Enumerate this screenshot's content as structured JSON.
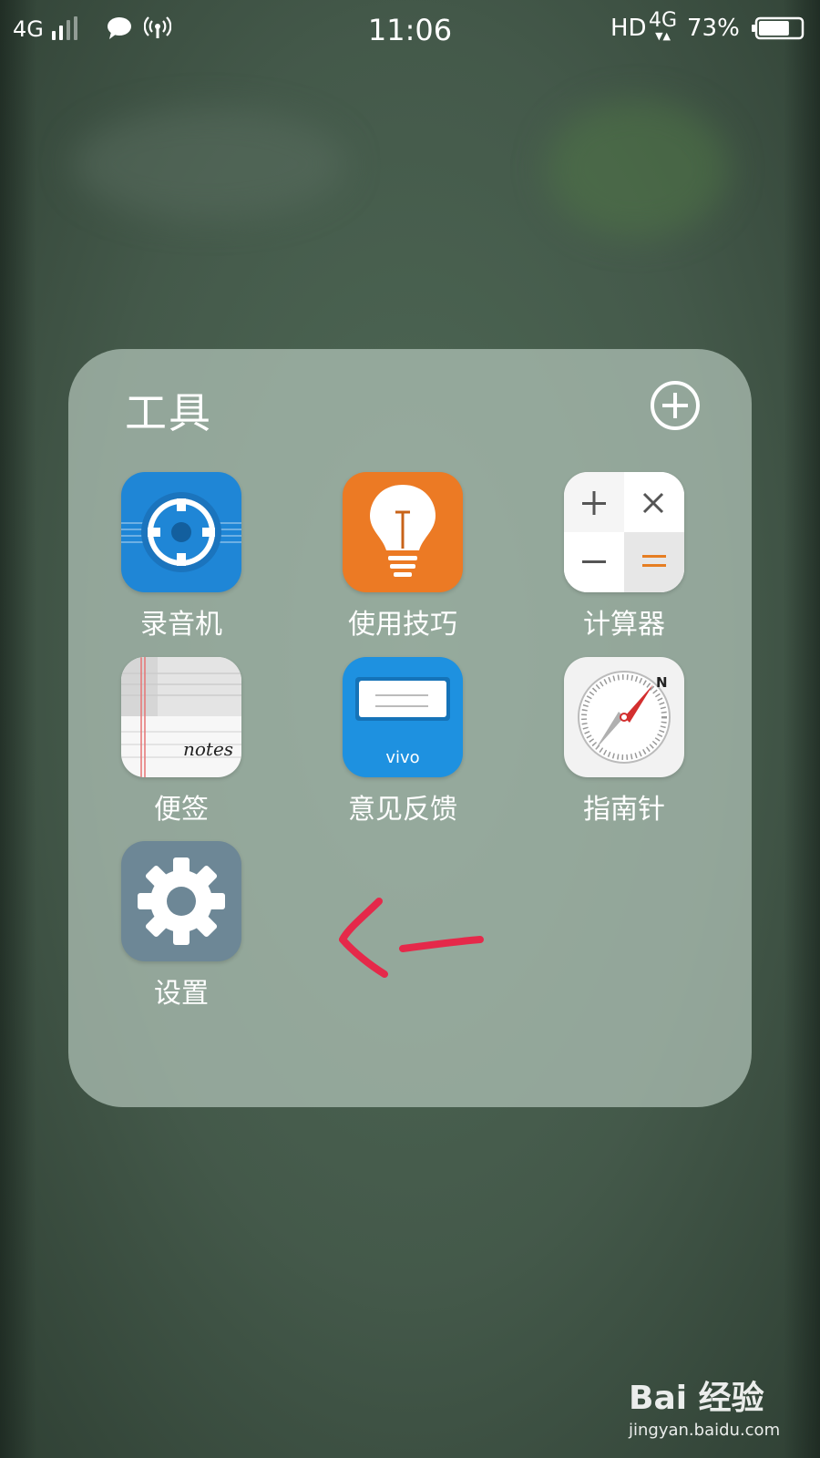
{
  "status_bar": {
    "network": "4G",
    "time": "11:06",
    "hd": "HD",
    "net_type": "4G",
    "battery_percent": "73%",
    "battery_level": 0.73,
    "icons": [
      "signal-icon",
      "chat-icon",
      "hotspot-icon",
      "battery-icon"
    ]
  },
  "folder": {
    "title": "工具",
    "add_icon": "plus-circle-icon",
    "apps": [
      {
        "label": "录音机",
        "icon": "recorder-icon",
        "color": "#1f86d6"
      },
      {
        "label": "使用技巧",
        "icon": "lightbulb-icon",
        "color": "#ec7a24"
      },
      {
        "label": "计算器",
        "icon": "calculator-icon",
        "color": "#f2f2f2"
      },
      {
        "label": "便签",
        "icon": "notes-icon",
        "color": "#f7f7f7",
        "text": "notes"
      },
      {
        "label": "意见反馈",
        "icon": "feedback-icon",
        "color": "#1e91e0",
        "text": "vivo"
      },
      {
        "label": "指南针",
        "icon": "compass-icon",
        "color": "#f2f2f2"
      },
      {
        "label": "设置",
        "icon": "settings-gear-icon",
        "color": "#6d8796"
      }
    ]
  },
  "annotation": {
    "color": "#e5294a",
    "icon": "red-arrow-annotation"
  },
  "watermark": {
    "logo": "Bai 经验",
    "url": "jingyan.baidu.com"
  }
}
